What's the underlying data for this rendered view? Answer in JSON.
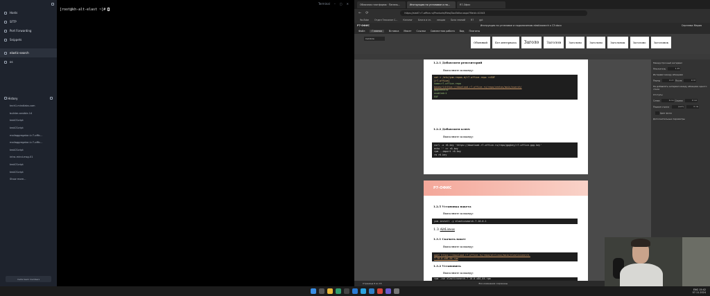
{
  "ssh": {
    "nav": [
      "Hosts",
      "SFTP",
      "Port Forwarding",
      "Snippets"
    ],
    "active_host": "elastic-search",
    "item_os": "os",
    "history_label": "History",
    "history": [
      "tech1.mindlabs.com",
      "builder-ansible-14",
      "testCScript",
      "testCScript",
      "mailaggregator-t.r7-offic...",
      "mailaggregator-t.r7-offic...",
      "testCScript",
      "intra-mind-msg-01",
      "testCScript",
      "testCScript",
      "Show more..."
    ],
    "bottom_button": "Invite team members",
    "prompt": "[root@kh-alt-elast ~]# ",
    "term_tab": "Terminal"
  },
  "browser": {
    "tabs": [
      "Облачная платформа · Панель...",
      "Инструкция по установке и на...",
      "R7-Офис"
    ],
    "url": "https://alalt7.r7-office.ru/Products/Files/DocEditor.aspx?fileid=41543",
    "bookmarks": [
      "YouTube",
      "Отдел Техсалон С...",
      "Каталог",
      "Блоги и сп.",
      "лекции",
      "База знаний",
      "R7",
      "gpt"
    ]
  },
  "editor": {
    "brand": "Р7-ОФИС",
    "title": "Инструкция по установке и подключению elasticsearch к СЭ.docx",
    "user": "Cергеева Мария",
    "menu": [
      "Файл",
      "Главная",
      "Вставка",
      "Макет",
      "Ссылки",
      "Совместная работа",
      "Вид",
      "Плагины"
    ],
    "font": "Cambria",
    "styles": [
      "Обычный",
      "Без интервала",
      "Заголо",
      "Заголов",
      "Заголово",
      "Заголово",
      "Заголовок",
      "Заголово",
      "Заголовок",
      "Заголовок",
      "Заголовок"
    ],
    "page1": {
      "h_repo": "1.2.1 Добавляем репозиторий",
      "note1": "Выполните команду:",
      "code1": [
        "cat > /etc/yum.repos.d/r7-office.repo <<EOF",
        "[r7-office]",
        "name=r7-office-repo",
        "baseurl=https://download.r7-office.ru/repo/centos/main/noarch/",
        "gpgcheck=0",
        "enabled=1",
        "EOF"
      ],
      "h_key": "1.2.2 Добавляем ключ",
      "note2": "Выполните команду:",
      "code2": [
        "curl -o r6.key 'https://download.r7-office.ru/repo/gpgkey/r7-office.gpg.key'",
        "echo '' >> r6.key",
        "rpm --import r6.key",
        "rm r6.key"
      ]
    },
    "page2": {
      "banner": "Р7-ОФИС",
      "h_install": "1.2.5 Установка пакета",
      "note3": "Выполните команду:",
      "code3": "yum install -y elasticsearch-7.10.0-1",
      "h_alt_num": "1.3",
      "h_alt": "AltLinux",
      "h_dl": "1.3.1 Скачать пакет",
      "note4": "Выполните команду:",
      "code4": [
        "wget https://download.r7-office.ru/repo/altlinux/main/elasticsearch-",
        "7.10.0-x86_64.rpm"
      ],
      "h_set": "1.3.2 Установить",
      "note5": "Выполните команду:",
      "code5": "rpm -ivh elasticsearch-7.10.0-x86_64.rpm"
    },
    "panel": {
      "h1": "Междустрочный интервал",
      "mult": "Множитель",
      "mult_val": "1.15",
      "spacing": "Интервал между абзацами",
      "before": "Перед",
      "after": "После",
      "b_val": "0 пт",
      "a_val": "0 пт",
      "chk": "Не добавлять интервал между абзацами одного стиля",
      "indents": "Отступы",
      "left": "Слева",
      "right": "Справа",
      "l_val": "0 см",
      "r_val": "0 см",
      "first": "Первая строка",
      "f_opt": "(нет)",
      "f_val": "0 см",
      "bg": "Цвет фона",
      "adv": "Дополнительные параметры"
    },
    "status": {
      "page": "Страница 6 из 15",
      "saved": "Все изменения сохранены"
    }
  },
  "tray": {
    "lang": "ENG",
    "time": "15:42",
    "date": "07.11.2024"
  },
  "colors": {
    "accent": "#f4a79a",
    "code_bg": "#1e1e1e"
  }
}
